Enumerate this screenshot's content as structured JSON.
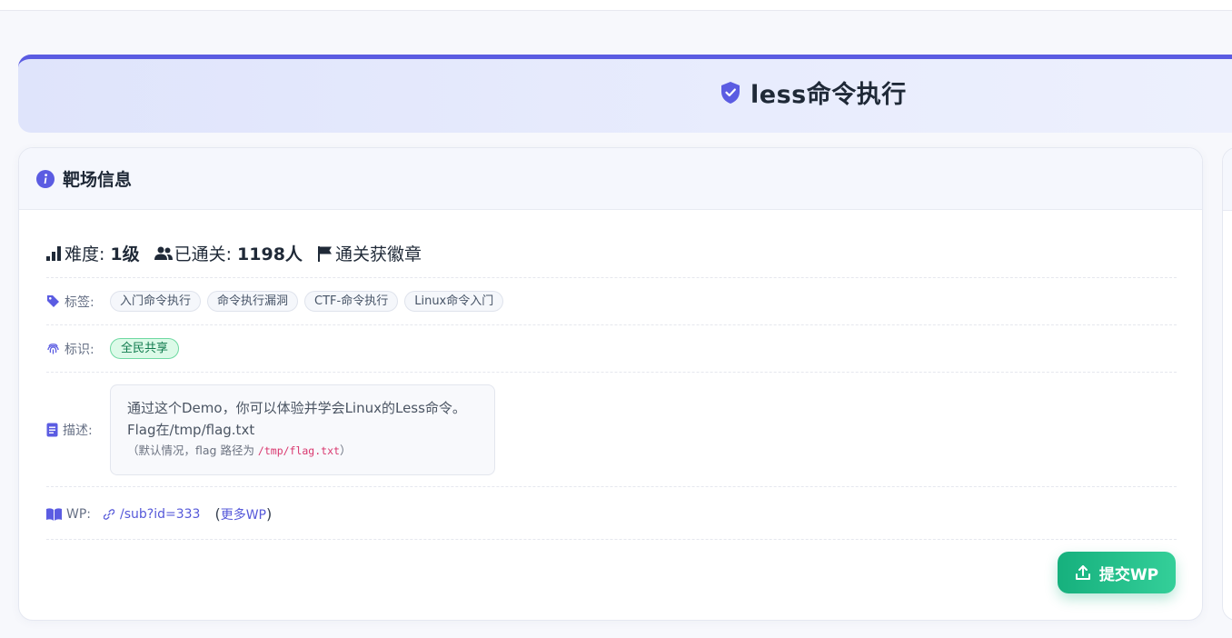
{
  "title": "less命令执行",
  "card": {
    "header": "靶场信息"
  },
  "stats": {
    "difficulty_label": "难度:",
    "difficulty_value": "1级",
    "solved_label": "已通关:",
    "solved_value": "1198人",
    "badge_text": "通关获徽章"
  },
  "tags": {
    "label": "标签:",
    "items": [
      "入门命令执行",
      "命令执行漏洞",
      "CTF-命令执行",
      "Linux命令入门"
    ]
  },
  "identity": {
    "label": "标识:",
    "badge": "全民共享"
  },
  "description": {
    "label": "描述:",
    "line1": "通过这个Demo，你可以体验并学会Linux的Less命令。",
    "line2": "Flag在/tmp/flag.txt",
    "note_prefix": "（默认情况，flag 路径为 ",
    "note_path": "/tmp/flag.txt",
    "note_suffix": "）"
  },
  "wp": {
    "label": "WP:",
    "link": "/sub?id=333",
    "more_open": "(",
    "more_link": "更多WP",
    "more_close": ")"
  },
  "submit_button": "提交WP",
  "colors": {
    "accent": "#5b5ce2",
    "success": "#16b07d",
    "link": "#5558d9",
    "code": "#d9376e"
  }
}
